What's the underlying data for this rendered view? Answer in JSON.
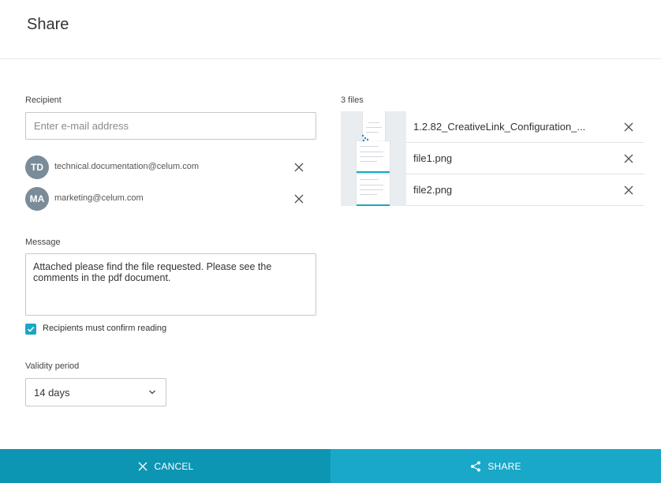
{
  "dialog": {
    "title": "Share"
  },
  "recipient": {
    "label": "Recipient",
    "placeholder": "Enter e-mail address",
    "list": [
      {
        "initials": "TD",
        "email": "technical.documentation@celum.com"
      },
      {
        "initials": "MA",
        "email": "marketing@celum.com"
      }
    ]
  },
  "message": {
    "label": "Message",
    "value": "Attached please find the file requested. Please see the comments in the pdf document."
  },
  "confirm_reading": {
    "label": "Recipients must confirm reading",
    "checked": true
  },
  "validity": {
    "label": "Validity period",
    "value": "14 days"
  },
  "files": {
    "count_label": "3 files",
    "items": [
      {
        "name": "1.2.82_CreativeLink_Configuration_..."
      },
      {
        "name": "file1.png"
      },
      {
        "name": "file2.png"
      }
    ]
  },
  "footer": {
    "cancel_label": "CANCEL",
    "share_label": "SHARE"
  },
  "colors": {
    "accent": "#19a8c7",
    "cancel_bg": "#0d96b3",
    "avatar": "#7a8c99"
  },
  "icons": {
    "remove": "close-icon",
    "check": "check-icon",
    "dropdown": "chevron-down-icon",
    "share": "share-icon",
    "cancel": "close-icon"
  }
}
